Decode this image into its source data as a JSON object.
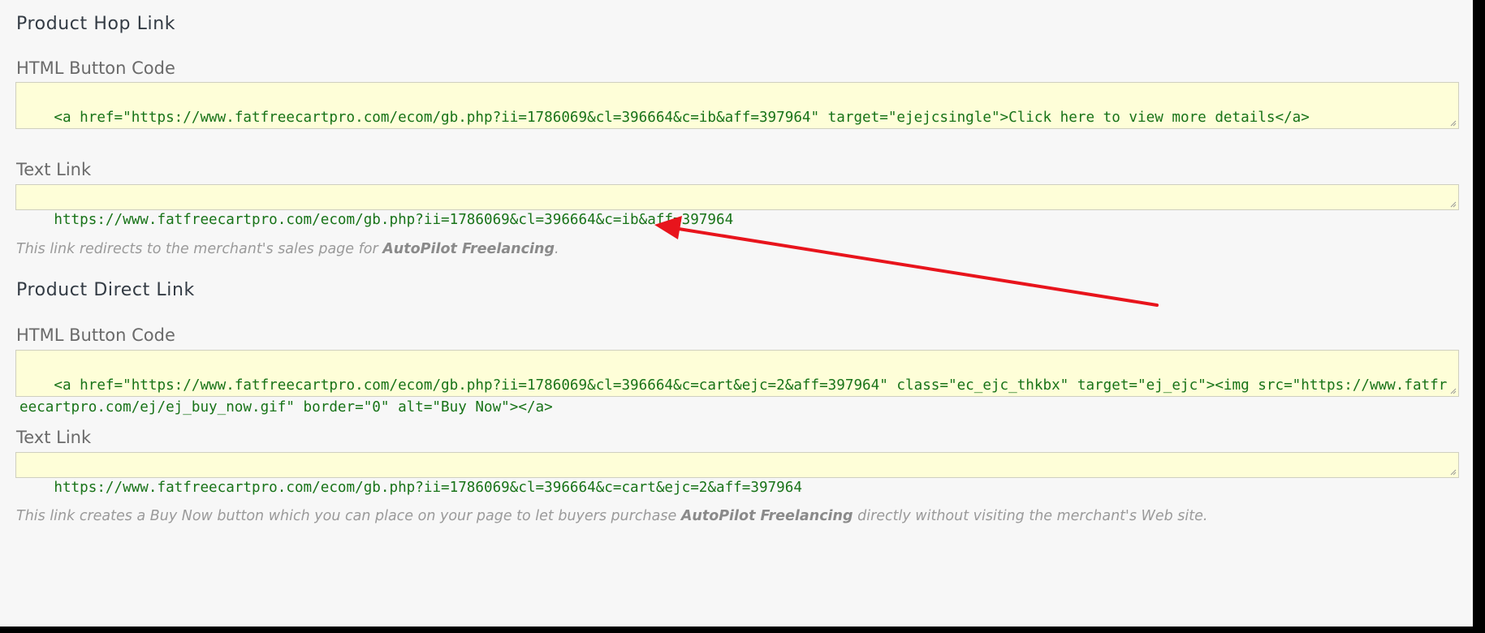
{
  "hop_link": {
    "title": "Product Hop Link",
    "html_label": "HTML Button Code",
    "html_code": "<a href=\"https://www.fatfreecartpro.com/ecom/gb.php?ii=1786069&cl=396664&c=ib&aff=397964\" target=\"ejejcsingle\">Click here to view more details</a>",
    "text_label": "Text Link",
    "text_link": "https://www.fatfreecartpro.com/ecom/gb.php?ii=1786069&cl=396664&c=ib&aff=397964",
    "note_prefix": "This link redirects to the merchant's sales page for ",
    "note_product": "AutoPilot Freelancing",
    "note_suffix": "."
  },
  "direct_link": {
    "title": "Product Direct Link",
    "html_label": "HTML Button Code",
    "html_code": "<a href=\"https://www.fatfreecartpro.com/ecom/gb.php?ii=1786069&cl=396664&c=cart&ejc=2&aff=397964\" class=\"ec_ejc_thkbx\" target=\"ej_ejc\"><img src=\"https://www.fatfreecartpro.com/ej/ej_buy_now.gif\" border=\"0\" alt=\"Buy Now\"></a>",
    "text_label": "Text Link",
    "text_link": "https://www.fatfreecartpro.com/ecom/gb.php?ii=1786069&cl=396664&c=cart&ejc=2&aff=397964",
    "note_prefix": "This link creates a Buy Now button which you can place on your page to let buyers purchase ",
    "note_product": "AutoPilot Freelancing",
    "note_suffix": " directly without visiting the merchant's Web site."
  },
  "colors": {
    "code_background": "#fefed8",
    "code_text": "#187318",
    "annotation_arrow": "#e8141c"
  }
}
